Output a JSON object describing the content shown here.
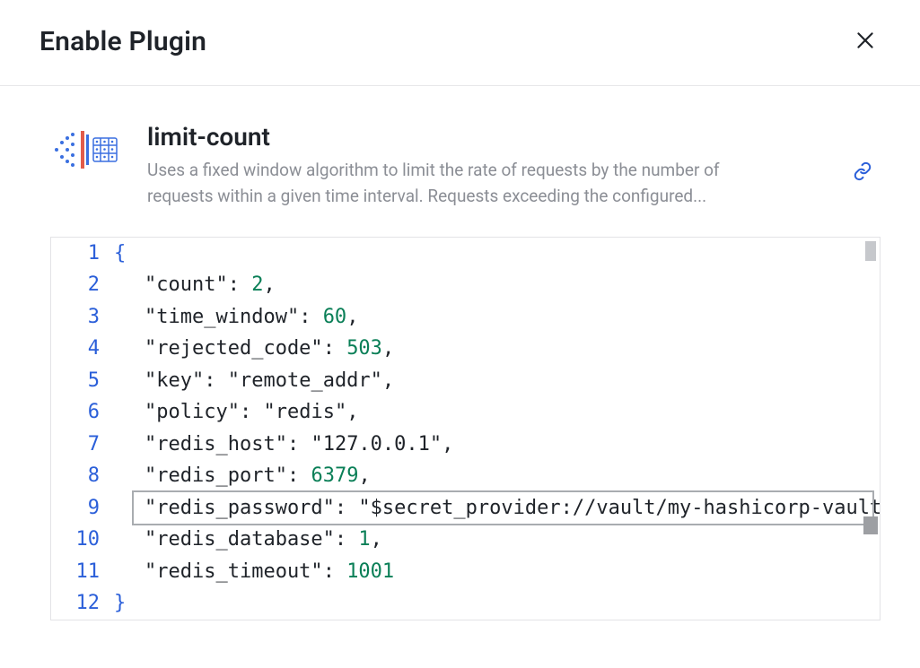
{
  "modal": {
    "title": "Enable Plugin",
    "close_aria": "Close"
  },
  "plugin": {
    "name": "limit-count",
    "description": "Uses a fixed window algorithm to limit the rate of requests by the number of requests within a given time interval. Requests exceeding the configured...",
    "docs_aria": "Open documentation"
  },
  "editor": {
    "lines": [
      {
        "n": 1,
        "kind": "brace-open",
        "text": "{"
      },
      {
        "n": 2,
        "kind": "kv-num",
        "key": "\"count\"",
        "value": "2",
        "comma": ","
      },
      {
        "n": 3,
        "kind": "kv-num",
        "key": "\"time_window\"",
        "value": "60",
        "comma": ","
      },
      {
        "n": 4,
        "kind": "kv-num",
        "key": "\"rejected_code\"",
        "value": "503",
        "comma": ","
      },
      {
        "n": 5,
        "kind": "kv-str",
        "key": "\"key\"",
        "value": "\"remote_addr\"",
        "comma": ","
      },
      {
        "n": 6,
        "kind": "kv-str",
        "key": "\"policy\"",
        "value": "\"redis\"",
        "comma": ","
      },
      {
        "n": 7,
        "kind": "kv-str",
        "key": "\"redis_host\"",
        "value": "\"127.0.0.1\"",
        "comma": ","
      },
      {
        "n": 8,
        "kind": "kv-num",
        "key": "\"redis_port\"",
        "value": "6379",
        "comma": ","
      },
      {
        "n": 9,
        "kind": "kv-str",
        "key": "\"redis_password\"",
        "value": "\"$secret_provider://vault/my-hashicorp-vault/my-s",
        "comma": ""
      },
      {
        "n": 10,
        "kind": "kv-num",
        "key": "\"redis_database\"",
        "value": "1",
        "comma": ","
      },
      {
        "n": 11,
        "kind": "kv-num",
        "key": "\"redis_timeout\"",
        "value": "1001",
        "comma": ""
      },
      {
        "n": 12,
        "kind": "brace-close",
        "text": "}"
      }
    ],
    "highlight_line": 9
  }
}
